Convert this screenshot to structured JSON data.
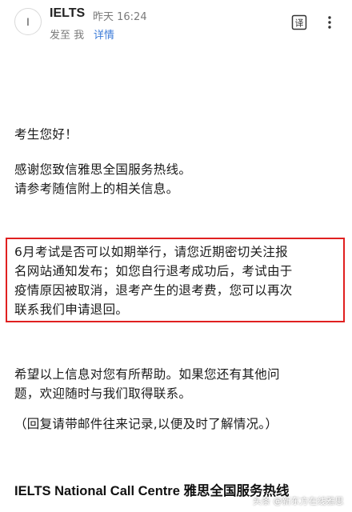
{
  "header": {
    "avatar_letter": "I",
    "sender": "IELTS",
    "time": "昨天 16:24",
    "to_line": "发至 我",
    "details_link": "详情",
    "translate_icon": "translate-icon",
    "more_icon": "more-icon"
  },
  "body": {
    "greeting": "考生您好！",
    "thanks_lines": [
      "感谢您致信雅思全国服务热线。",
      "请参考随信附上的相关信息。"
    ],
    "notice_lines": [
      "6月考试是否可以如期举行，请您近期密切关注报",
      "名网站通知发布；如您自行退考成功后，考试由于",
      "疫情原因被取消，退考产生的退考费，您可以再次",
      "联系我们申请退回。"
    ],
    "hope_lines": [
      "希望以上信息对您有所帮助。如果您还有其他问",
      "题，欢迎随时与我们取得联系。"
    ],
    "reply_note": "（回复请带邮件往来记录,以便及时了解情况。）",
    "signature": "IELTS National Call Centre 雅思全国服务热线"
  },
  "watermark": "头条 @新东方在线雅思",
  "colors": {
    "link": "#3b7bd8",
    "highlight_border": "#e02020",
    "meta_text": "#7a7a7a"
  }
}
